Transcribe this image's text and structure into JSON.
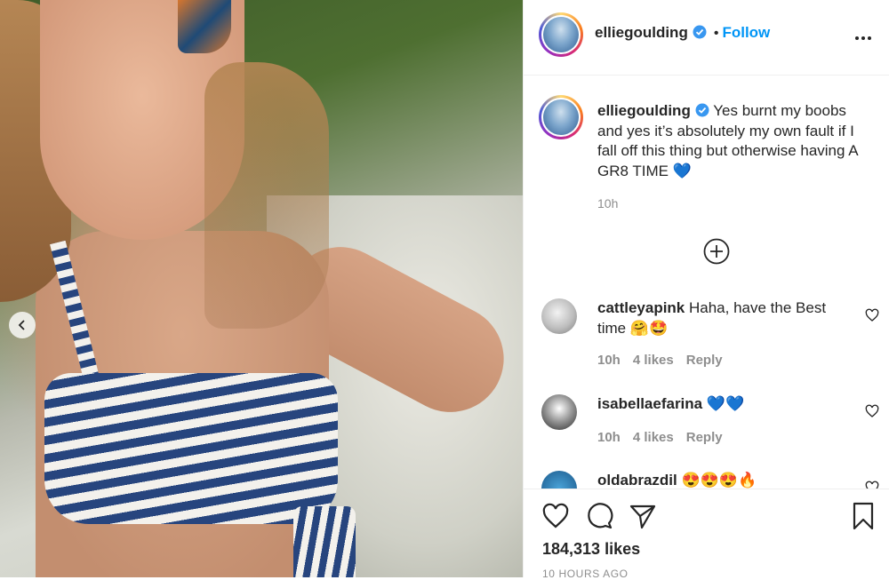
{
  "post": {
    "image_alt": "Selfie photo",
    "author": "elliegoulding",
    "follow_label": "Follow",
    "separator": "•",
    "caption_text": "Yes burnt my boobs and yes it’s absolutely my own fault if I fall off this thing but otherwise having A GR8 TIME 💙",
    "caption_time": "10h"
  },
  "comments": [
    {
      "user": "cattleyapink",
      "text": "Haha, have the Best time 🤗🤩",
      "time": "10h",
      "likes": "4 likes",
      "reply": "Reply"
    },
    {
      "user": "isabellaefarina",
      "text": "💙💙",
      "time": "10h",
      "likes": "4 likes",
      "reply": "Reply"
    },
    {
      "user": "oldabrazdil",
      "text": "😍😍😍🔥"
    }
  ],
  "actions": {
    "likes": "184,313 likes",
    "posted": "10 HOURS AGO"
  },
  "colors": {
    "link": "#0095f6",
    "muted": "#8e8e8e",
    "text": "#262626",
    "verified": "#3897f0"
  },
  "icons": [
    "chevron-left-icon",
    "verified-icon",
    "more-icon",
    "add-circle-icon",
    "heart-icon",
    "comment-icon",
    "share-icon",
    "bookmark-icon"
  ]
}
